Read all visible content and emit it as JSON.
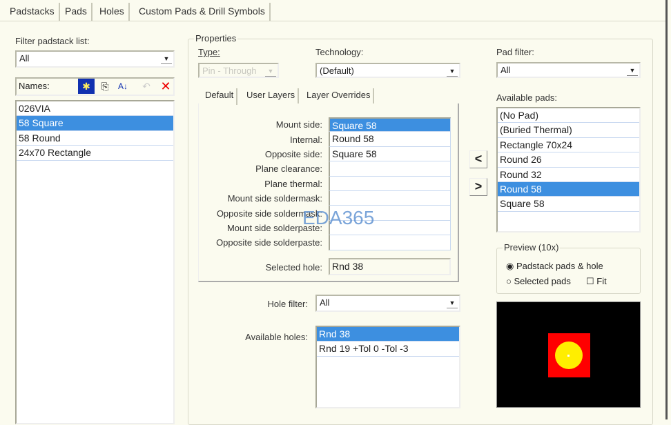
{
  "tabs": [
    "Padstacks",
    "Pads",
    "Holes",
    "Custom Pads & Drill Symbols"
  ],
  "filter": {
    "label": "Filter padstack list:",
    "value": "All"
  },
  "names": {
    "label": "Names:",
    "items": [
      "026VIA",
      "58 Square",
      "58 Round",
      "24x70 Rectangle"
    ],
    "selected": 1
  },
  "properties": {
    "legend": "Properties",
    "type_label": "Type:",
    "type_value": "Pin - Through",
    "technology_label": "Technology:",
    "technology_value": "(Default)",
    "inner_tabs": [
      "Default",
      "User Layers",
      "Layer Overrides"
    ],
    "layers": [
      {
        "label": "Mount side:",
        "value": "Square 58"
      },
      {
        "label": "Internal:",
        "value": "Round 58"
      },
      {
        "label": "Opposite side:",
        "value": "Square 58"
      },
      {
        "label": "Plane clearance:",
        "value": ""
      },
      {
        "label": "Plane thermal:",
        "value": ""
      },
      {
        "label": "Mount side soldermask:",
        "value": ""
      },
      {
        "label": "Opposite side soldermask:",
        "value": ""
      },
      {
        "label": "Mount side solderpaste:",
        "value": ""
      },
      {
        "label": "Opposite side solderpaste:",
        "value": ""
      }
    ],
    "selected_hole_label": "Selected hole:",
    "selected_hole_value": "Rnd 38",
    "hole_filter_label": "Hole filter:",
    "hole_filter_value": "All",
    "available_holes_label": "Available holes:",
    "holes": [
      "Rnd 38",
      "Rnd 19 +Tol 0 -Tol -3"
    ],
    "pad_filter_label": "Pad filter:",
    "pad_filter_value": "All",
    "available_pads_label": "Available pads:",
    "pads": [
      "(No Pad)",
      "(Buried Thermal)",
      "Rectangle 70x24",
      "Round 26",
      "Round 32",
      "Round 58",
      "Square 58"
    ],
    "selected_pad": 5,
    "preview": {
      "legend": "Preview (10x)",
      "option1": "Padstack pads & hole",
      "option2": "Selected pads",
      "fit": "Fit"
    }
  },
  "arrows": {
    "left": "<",
    "right": ">"
  },
  "watermark": "EDA365",
  "colors": {
    "selection": "#3d8fe0",
    "pad": "#ff0000",
    "hole": "#ffee00"
  }
}
